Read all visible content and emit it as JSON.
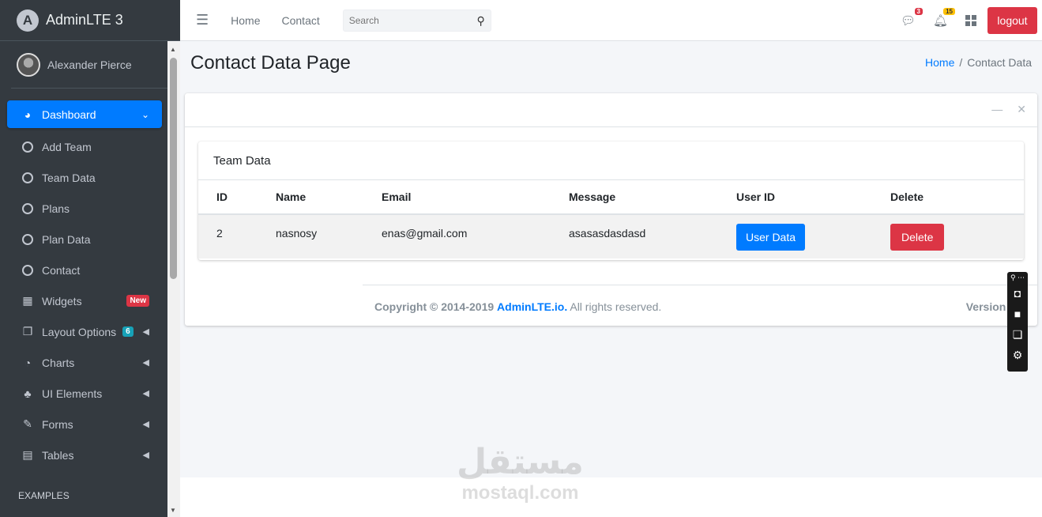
{
  "brand": {
    "logo_letter": "A",
    "name": "AdminLTE 3"
  },
  "user": {
    "name": "Alexander Pierce"
  },
  "sidebar": {
    "items": [
      {
        "label": "Dashboard",
        "icon": "tachometer-icon",
        "active": true
      },
      {
        "label": "Add Team",
        "icon": "circle-icon"
      },
      {
        "label": "Team Data",
        "icon": "circle-icon"
      },
      {
        "label": "Plans",
        "icon": "circle-icon"
      },
      {
        "label": "Plan Data",
        "icon": "circle-icon"
      },
      {
        "label": "Contact",
        "icon": "circle-icon"
      },
      {
        "label": "Widgets",
        "icon": "th-icon",
        "badge": "New"
      },
      {
        "label": "Layout Options",
        "icon": "copy-icon",
        "badge": "6"
      },
      {
        "label": "Charts",
        "icon": "pie-chart-icon"
      },
      {
        "label": "UI Elements",
        "icon": "tree-icon"
      },
      {
        "label": "Forms",
        "icon": "edit-icon"
      },
      {
        "label": "Tables",
        "icon": "table-icon"
      }
    ],
    "header": "EXAMPLES"
  },
  "topbar": {
    "links": [
      "Home",
      "Contact"
    ],
    "search_placeholder": "Search",
    "messages_count": "3",
    "notifications_count": "15",
    "logout_label": "logout"
  },
  "page": {
    "title": "Contact Data Page",
    "breadcrumb_home": "Home",
    "breadcrumb_current": "Contact Data"
  },
  "table": {
    "title": "Team Data",
    "headers": [
      "ID",
      "Name",
      "Email",
      "Message",
      "User ID",
      "Delete"
    ],
    "rows": [
      {
        "id": "2",
        "name": "nasnosy",
        "email": "enas@gmail.com",
        "message": "asasasdasdasd",
        "user_btn": "User Data",
        "delete_btn": "Delete"
      }
    ]
  },
  "footer": {
    "copyright_prefix": "Copyright © 2014-2019",
    "brand_link": "AdminLTE.io.",
    "rights": "All rights reserved.",
    "version": "Version 3"
  },
  "watermark": {
    "arabic": "مستقل",
    "latin": "mostaql.com"
  },
  "colors": {
    "primary": "#007bff",
    "danger": "#dc3545",
    "sidebar": "#343a40"
  }
}
